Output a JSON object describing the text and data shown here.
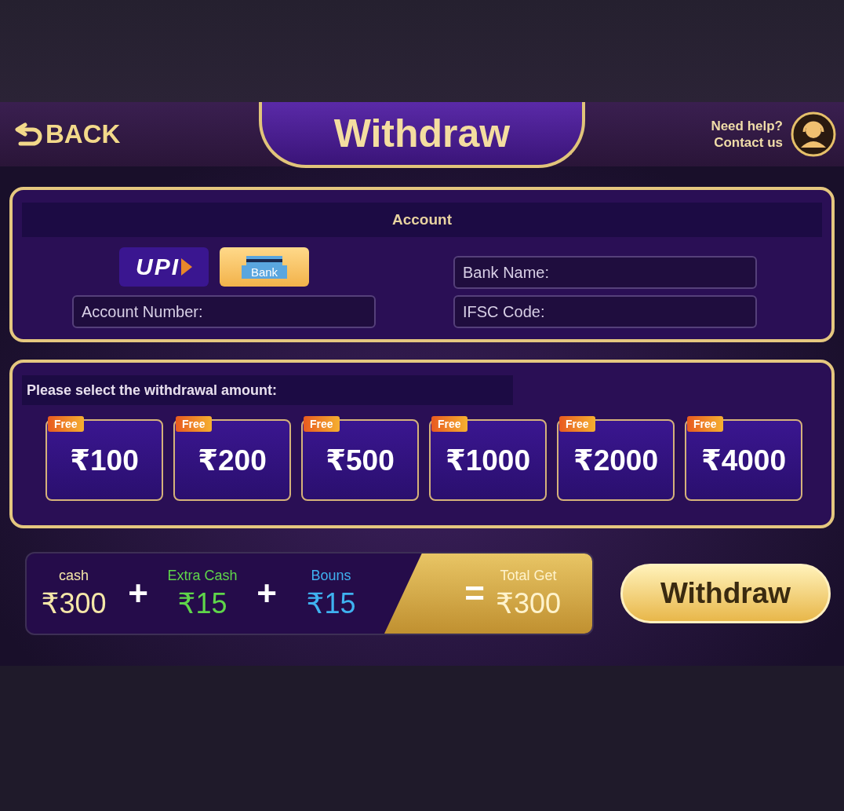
{
  "header": {
    "back_label": "BACK",
    "title": "Withdraw",
    "help_text": "Need help? Contact us"
  },
  "account": {
    "title": "Account",
    "methods": [
      {
        "kind": "upi",
        "label": "UPI",
        "selected": false
      },
      {
        "kind": "bank",
        "label": "Bank",
        "selected": true
      }
    ],
    "fields": [
      {
        "placeholder": "Account Number:"
      },
      {
        "placeholder": "Bank Name:"
      },
      {
        "placeholder": "IFSC Code:"
      }
    ]
  },
  "amount": {
    "prompt": "Please select the withdrawal amount:",
    "options": [
      {
        "tag": "Free",
        "value": "₹100",
        "selected": false
      },
      {
        "tag": "Free",
        "value": "₹200",
        "selected": false
      },
      {
        "tag": "Free",
        "value": "₹500",
        "selected": false
      },
      {
        "tag": "Free",
        "value": "₹1000",
        "selected": false
      },
      {
        "tag": "Free",
        "value": "₹2000",
        "selected": false
      },
      {
        "tag": "Free",
        "value": "₹4000",
        "selected": false
      }
    ]
  },
  "summary": {
    "terms": [
      {
        "label": "cash",
        "value": "₹300",
        "color": "#f5e7a8"
      },
      {
        "label": "Extra Cash",
        "value": "₹15",
        "color": "#5fd64a"
      },
      {
        "label": "Bouns",
        "value": "₹15",
        "color": "#3fb2f0"
      }
    ],
    "operators": [
      "+",
      "+",
      "="
    ],
    "total": {
      "label": "Total Get",
      "value": "₹300"
    }
  },
  "withdraw_button": "Withdraw"
}
